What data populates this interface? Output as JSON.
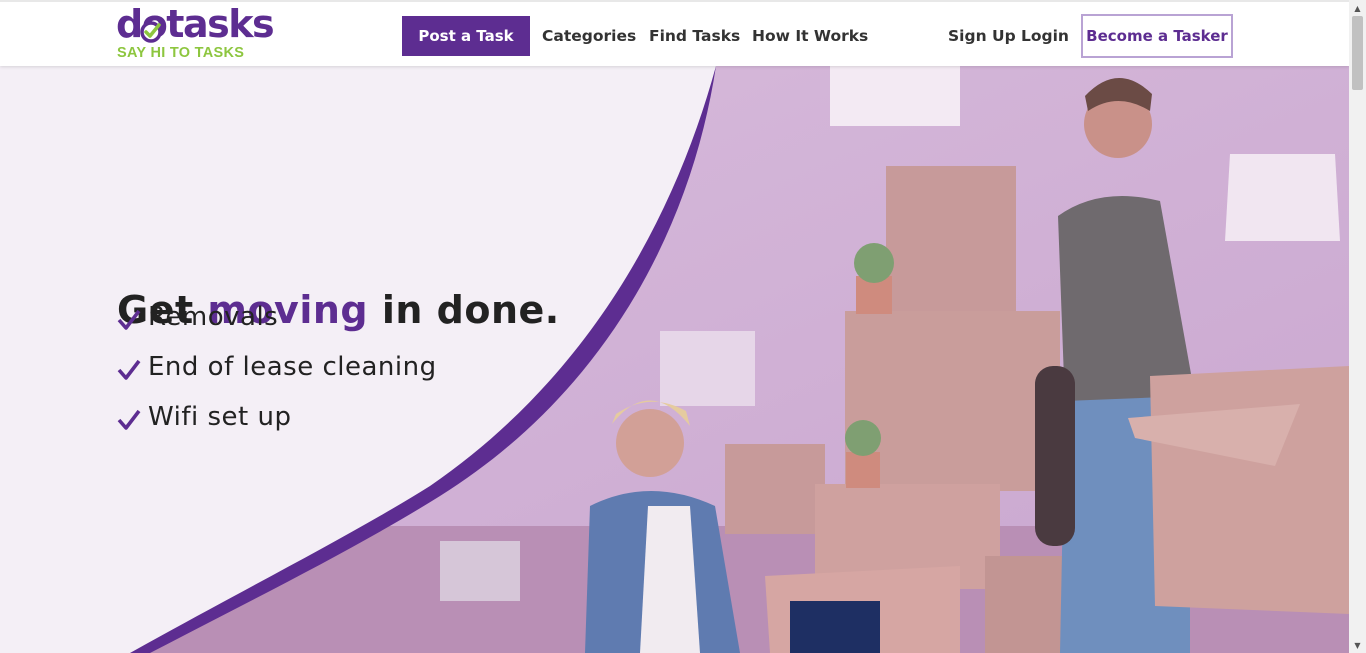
{
  "brand": {
    "name": "dotasks",
    "tagline": "SAY HI TO TASKS",
    "primary": "#5d2d91",
    "secondary": "#8dc63f"
  },
  "nav": {
    "post_task": "Post a Task",
    "categories": "Categories",
    "find_tasks": "Find Tasks",
    "how_it_works": "How It Works",
    "sign_up": "Sign Up",
    "login": "Login",
    "become_tasker": "Become a Tasker"
  },
  "hero": {
    "headline_pre": "Get ",
    "headline_accent": "moving",
    "headline_post": " in done.",
    "items": [
      "Removals",
      "End of lease cleaning",
      "Wifi set up"
    ],
    "check_icon": "checkmark-icon",
    "image": "people-moving-boxes-photo"
  }
}
